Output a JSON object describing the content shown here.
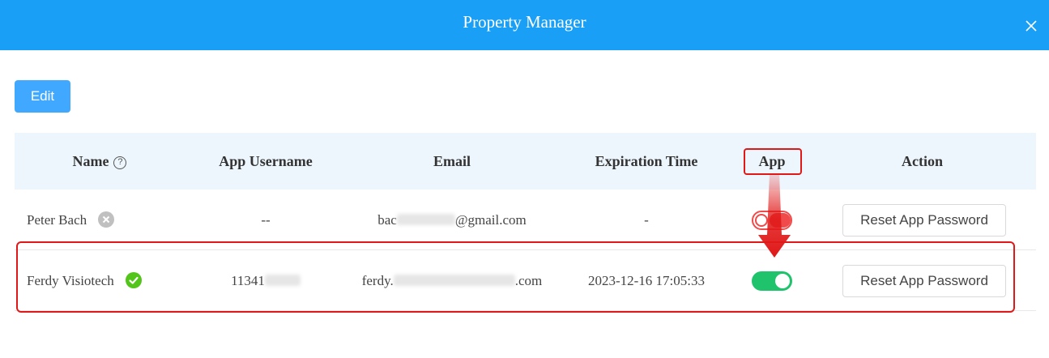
{
  "dialog": {
    "title": "Property Manager",
    "close_icon": "close-icon"
  },
  "toolbar": {
    "edit_label": "Edit"
  },
  "table": {
    "headers": {
      "name": "Name",
      "app_username": "App Username",
      "email": "Email",
      "expiration_time": "Expiration Time",
      "app": "App",
      "action": "Action"
    },
    "rows": [
      {
        "name": "Peter Bach",
        "status_icon": "x-circle-icon",
        "app_username": "--",
        "email_visible_start": "bac",
        "email_visible_end": "@gmail.com",
        "expiration_time": "-",
        "app_enabled": false,
        "action_label": "Reset App Password"
      },
      {
        "name": "Ferdy Visiotech",
        "status_icon": "check-circle-icon",
        "app_username": "11341",
        "email_visible_start": "ferdy.",
        "email_visible_end": ".com",
        "expiration_time": "2023-12-16 17:05:33",
        "app_enabled": true,
        "action_label": "Reset App Password"
      }
    ]
  },
  "colors": {
    "header_bar": "#1a9ff7",
    "primary_button": "#40a9ff",
    "toggle_on": "#1fc36b",
    "toggle_off": "#f04a4a",
    "highlight": "#e01818"
  }
}
